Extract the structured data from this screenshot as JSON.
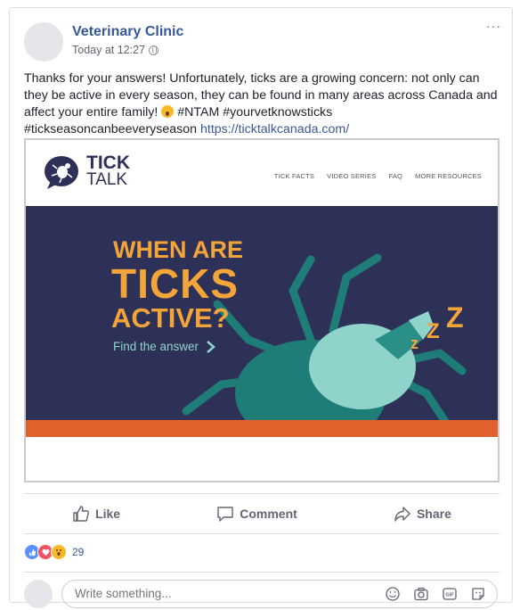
{
  "post": {
    "page_name": "Veterinary Clinic",
    "timestamp": "Today at 12:27",
    "more_label": "···",
    "text_main": "Thanks for your answers! Unfortunately, ticks are a growing concern: not only can they be active in every season, they can be found in many areas across Canada and affect your entire family!",
    "text_tags": "#NTAM #yourvetknowsticks #tickseasoncanbeeveryseason",
    "link": "https://ticktalkcanada.com/"
  },
  "preview": {
    "logo_line1": "TICK",
    "logo_line2": "TALK",
    "nav": [
      "TICK FACTS",
      "VIDEO SERIES",
      "FAQ",
      "MORE RESOURCES"
    ],
    "headline_1": "WHEN ARE",
    "headline_2": "TICKS",
    "headline_3": "ACTIVE?",
    "cta": "Find the answer",
    "zzz": "ZZZ",
    "colors": {
      "banner": "#2e3157",
      "orange": "#e2622d",
      "accent": "#f3a53a",
      "teal": "#8fd3cb"
    }
  },
  "actions": {
    "like": "Like",
    "comment": "Comment",
    "share": "Share"
  },
  "reactions": {
    "count": "29",
    "icons": [
      "like-icon",
      "love-icon",
      "wow-icon"
    ]
  },
  "comment": {
    "placeholder": "Write something..."
  },
  "icons": [
    "globe-icon",
    "more-icon",
    "thumbs-up-icon",
    "comment-bubble-icon",
    "share-arrow-icon",
    "emoji-icon",
    "camera-icon",
    "gif-icon",
    "sticker-icon"
  ]
}
